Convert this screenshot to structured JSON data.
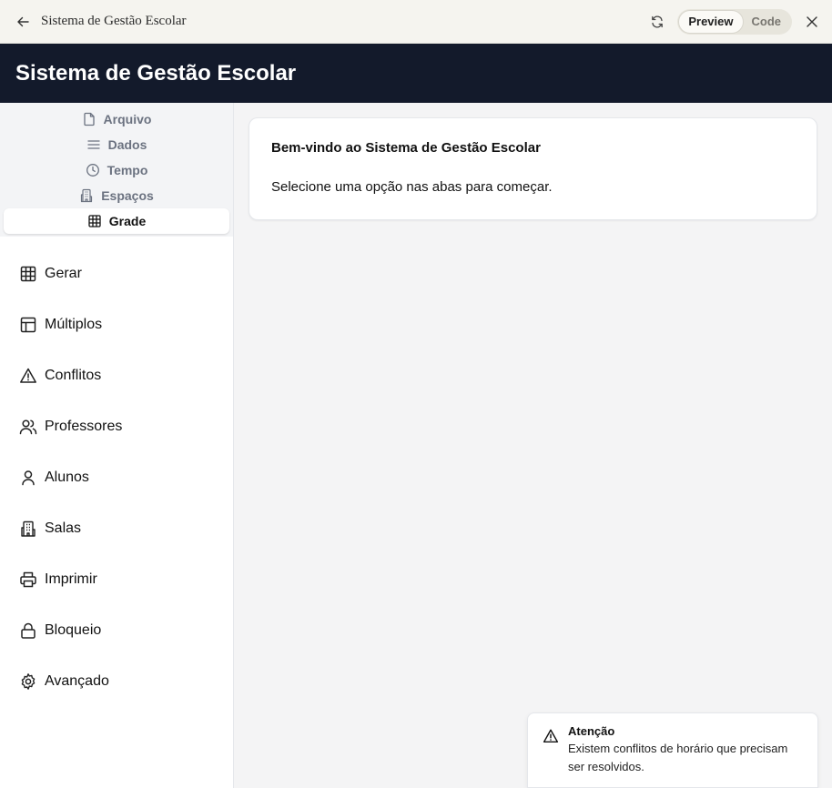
{
  "window": {
    "title": "Sistema de Gestão Escolar",
    "toggle": {
      "preview": "Preview",
      "code": "Code",
      "active": "Preview"
    }
  },
  "header": {
    "title": "Sistema de Gestão Escolar"
  },
  "tabs": [
    {
      "label": "Arquivo",
      "icon": "file-icon",
      "active": false
    },
    {
      "label": "Dados",
      "icon": "menu-lines-icon",
      "active": false
    },
    {
      "label": "Tempo",
      "icon": "clock-icon",
      "active": false
    },
    {
      "label": "Espaços",
      "icon": "building-icon",
      "active": false
    },
    {
      "label": "Grade",
      "icon": "grid-icon",
      "active": true
    }
  ],
  "nav": [
    {
      "label": "Gerar",
      "icon": "grid-icon"
    },
    {
      "label": "Múltiplos",
      "icon": "layout-icon"
    },
    {
      "label": "Conflitos",
      "icon": "warning-icon"
    },
    {
      "label": "Professores",
      "icon": "users-icon"
    },
    {
      "label": "Alunos",
      "icon": "user-icon"
    },
    {
      "label": "Salas",
      "icon": "building-icon"
    },
    {
      "label": "Imprimir",
      "icon": "printer-icon"
    },
    {
      "label": "Bloqueio",
      "icon": "lock-icon"
    },
    {
      "label": "Avançado",
      "icon": "gear-icon"
    }
  ],
  "welcome": {
    "title": "Bem-vindo ao Sistema de Gestão Escolar",
    "message": "Selecione uma opção nas abas para começar."
  },
  "toast": {
    "title": "Atenção",
    "description": "Existem conflitos de horário que precisam ser resolvidos.",
    "icon": "warning-icon"
  },
  "colors": {
    "header_bg": "#131a2b",
    "window_bar_bg": "#f5f4ef",
    "main_bg": "#f4f4f5"
  }
}
